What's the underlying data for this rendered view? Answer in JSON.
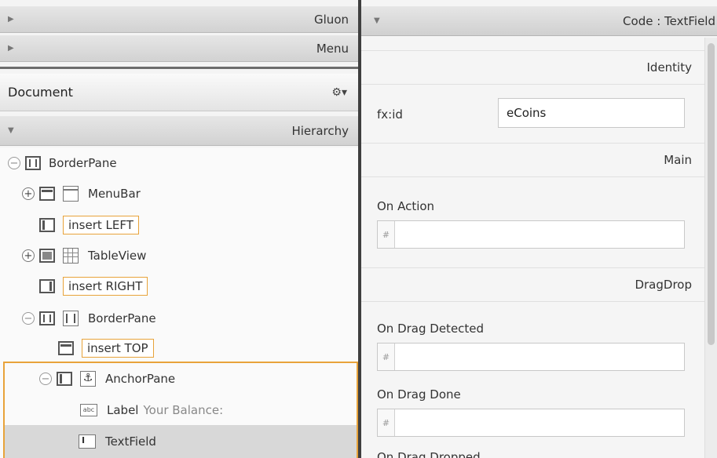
{
  "left_panel": {
    "gluon_header": "Gluon",
    "menu_header": "Menu",
    "document_title": "Document",
    "gear_glyph": "⚙▾",
    "hierarchy_header": "Hierarchy",
    "tree": [
      {
        "label": "BorderPane"
      },
      {
        "label": "MenuBar"
      },
      {
        "label": "insert LEFT"
      },
      {
        "label": "TableView"
      },
      {
        "label": "insert RIGHT"
      },
      {
        "label": "BorderPane"
      },
      {
        "label": "insert TOP"
      },
      {
        "label": "AnchorPane"
      },
      {
        "label": "Label",
        "extra": "Your Balance:"
      },
      {
        "label": "TextField"
      }
    ]
  },
  "right_panel": {
    "code_header": "Code : TextField",
    "sections": {
      "identity": "Identity",
      "main": "Main",
      "dragdrop": "DragDrop"
    },
    "fxid_label": "fx:id",
    "fxid_value": "eCoins",
    "on_action_label": "On Action",
    "on_drag_detected_label": "On Drag Detected",
    "on_drag_done_label": "On Drag Done",
    "on_drag_dropped_label": "On Drag Dropped",
    "hash_symbol": "#"
  },
  "colors": {
    "insert_highlight": "#e8a33a",
    "divider": "#3f3f3f",
    "selection": "#d8d8d8"
  }
}
